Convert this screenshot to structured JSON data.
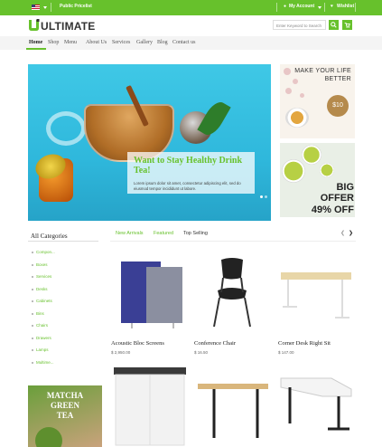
{
  "topbar": {
    "pricelist": "Public Pricelist",
    "account": "My Account",
    "wishlist": "Wishlist"
  },
  "brand": {
    "name": "ULTIMATE",
    "accent": "#67c12c"
  },
  "search": {
    "placeholder": "Enter Keyword to Search",
    "button_icon": "search-icon"
  },
  "nav": [
    {
      "label": "Home"
    },
    {
      "label": "Shop"
    },
    {
      "label": "Menu"
    },
    {
      "label": "About Us"
    },
    {
      "label": "Services"
    },
    {
      "label": "Gallery"
    },
    {
      "label": "Blog"
    },
    {
      "label": "Contact us"
    }
  ],
  "slider": {
    "title": "Want to Stay Healthy Drink Tea!",
    "text": "Lorem ipsum dolor sit amet, consectetur adipiscing elit, sed do eiusmod tempor incididunt ut labore."
  },
  "banners": {
    "top": {
      "title": "MAKE YOUR LIFE BETTER",
      "price": "$10"
    },
    "bottom": {
      "line1": "BIG",
      "line2": "OFFER",
      "line3": "49% OFF"
    }
  },
  "categories": {
    "title": "All Categories",
    "items": [
      "Compon...",
      "Boxes",
      "Services",
      "Desks",
      "Cabinets",
      "Bins",
      "Chairs",
      "Drawers",
      "Lamps",
      "Multime..."
    ]
  },
  "side_banner": {
    "line1": "MATCHA",
    "line2": "GREEN",
    "line3": "TEA"
  },
  "tabs": [
    {
      "label": "New Arrivals"
    },
    {
      "label": "Featured"
    },
    {
      "label": "Top Selling"
    }
  ],
  "products": [
    {
      "name": "Acoustic Bloc Screens",
      "price": "$ 2,950.00"
    },
    {
      "name": "Conference Chair",
      "price": "$ 16.50"
    },
    {
      "name": "Corner Desk Right Sit",
      "price": "$ 147.00"
    }
  ]
}
